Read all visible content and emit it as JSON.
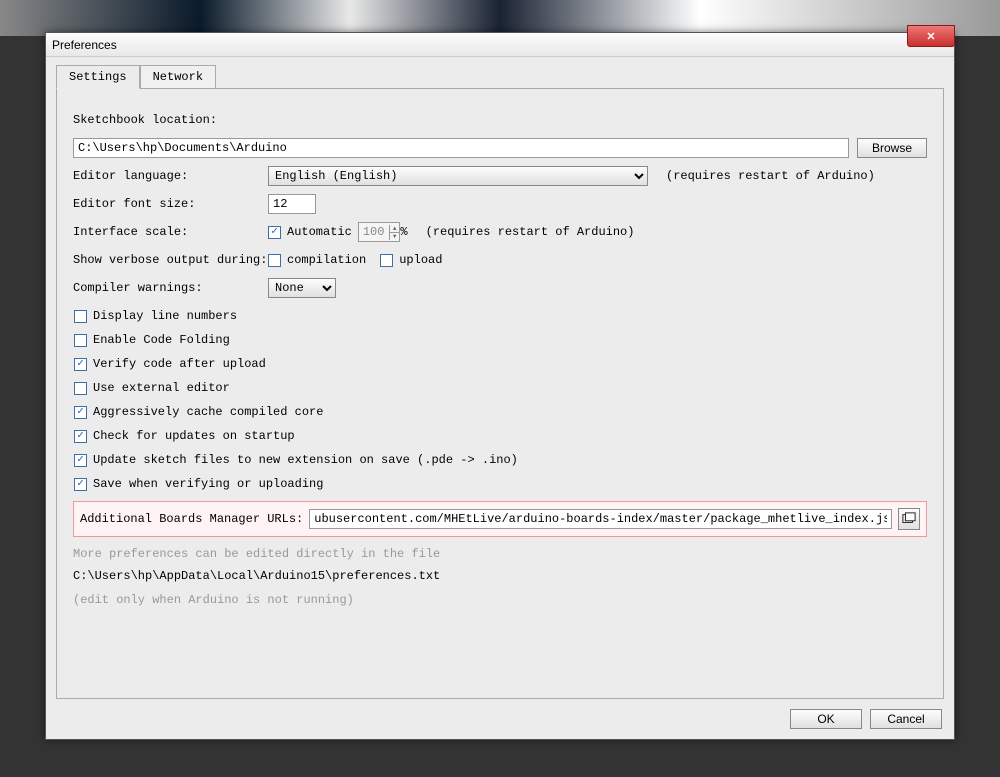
{
  "window": {
    "title": "Preferences"
  },
  "tabs": {
    "settings": "Settings",
    "network": "Network"
  },
  "labels": {
    "sketchbook": "Sketchbook location:",
    "language": "Editor language:",
    "fontsize": "Editor font size:",
    "scale": "Interface scale:",
    "verbose": "Show verbose output during:",
    "warnings": "Compiler warnings:",
    "boards_url": "Additional Boards Manager URLs:"
  },
  "values": {
    "sketchbook_path": "C:\\Users\\hp\\Documents\\Arduino",
    "language": "English (English)",
    "fontsize": "12",
    "scale_value": "100",
    "warnings": "None",
    "boards_url": "ubusercontent.com/MHEtLive/arduino-boards-index/master/package_mhetlive_index.json"
  },
  "buttons": {
    "browse": "Browse",
    "ok": "OK",
    "cancel": "Cancel"
  },
  "hints": {
    "restart": "(requires restart of Arduino)",
    "percent": "%"
  },
  "checkboxes": {
    "automatic": "Automatic",
    "compilation": "compilation",
    "upload": "upload",
    "display_line_numbers": "Display line numbers",
    "enable_code_folding": "Enable Code Folding",
    "verify_after_upload": "Verify code after upload",
    "use_external_editor": "Use external editor",
    "aggressive_cache": "Aggressively cache compiled core",
    "check_updates": "Check for updates on startup",
    "update_sketch_ext": "Update sketch files to new extension on save (.pde -> .ino)",
    "save_verify": "Save when verifying or uploading"
  },
  "footer_text": {
    "more_prefs": "More preferences can be edited directly in the file",
    "prefs_path": "C:\\Users\\hp\\AppData\\Local\\Arduino15\\preferences.txt",
    "edit_only": "(edit only when Arduino is not running)"
  }
}
